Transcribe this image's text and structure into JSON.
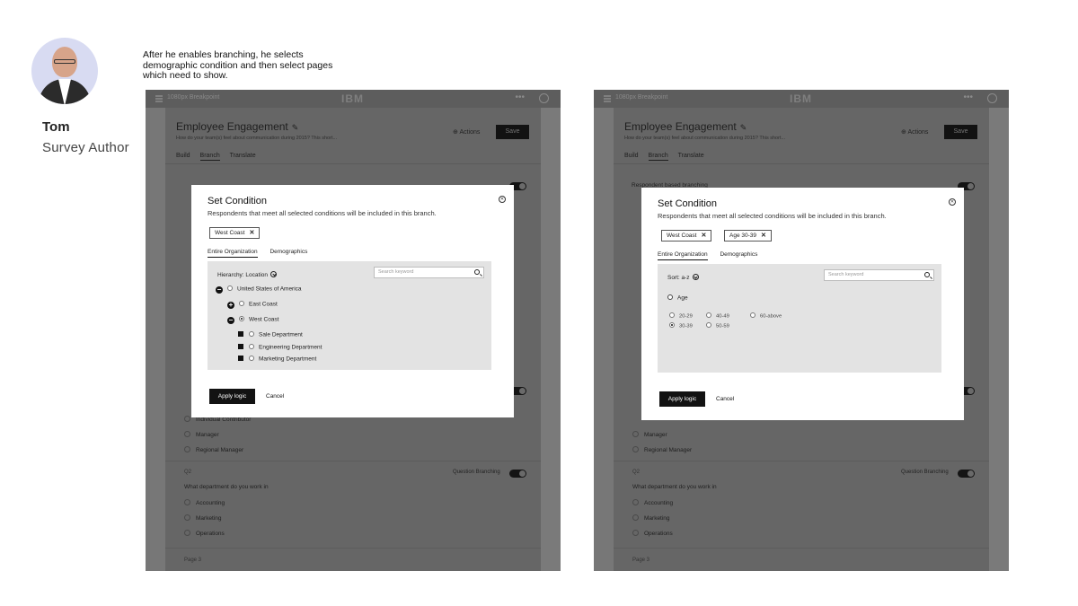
{
  "persona": {
    "name": "Tom",
    "role": "Survey Author",
    "caption": "After he enables branching, he selects demographic condition and then select pages which need to show."
  },
  "app": {
    "crumb": "1080px Breakpoint",
    "logo": "IBM",
    "more": "•••",
    "survey_title": "Employee Engagement",
    "survey_desc": "How do your team(s) feel about communication during 2015? This short...",
    "actions_label": "Actions",
    "save_label": "Save",
    "tabs": [
      "Build",
      "Branch",
      "Translate"
    ],
    "respondent_branching": "Respondent based branching",
    "question_branching": "Question Branching",
    "q1_options": [
      "Individual Contributor",
      "Manager",
      "Regional Manager"
    ],
    "q2_number": "Q2",
    "q2_text": "What department do you work in",
    "q2_options": [
      "Accounting",
      "Marketing",
      "Operations"
    ],
    "page3": "Page 3"
  },
  "modal1": {
    "title": "Set Condition",
    "subtitle": "Respondents that meet all selected conditions will be included in this branch.",
    "tags": [
      "West Coast"
    ],
    "tabs": [
      "Entire Organization",
      "Demographics"
    ],
    "hierarchy_label": "Hierarchy: Location",
    "search_placeholder": "Search keyword",
    "tree": {
      "country": "United States of America",
      "east": "East Coast",
      "west": "West Coast",
      "departments": [
        "Sale Department",
        "Engineering Department",
        "Marketing Department"
      ]
    },
    "apply_label": "Apply logic",
    "cancel_label": "Cancel"
  },
  "modal2": {
    "title": "Set Condition",
    "subtitle": "Respondents that meet all selected conditions will be included in this branch.",
    "tags": [
      "West Coast",
      "Age 30-39"
    ],
    "tabs": [
      "Entire Organization",
      "Demographics"
    ],
    "sort_label": "Sort: a-z",
    "search_placeholder": "Search keyword",
    "age_label": "Age",
    "age_options": [
      "20-29",
      "40-49",
      "60-above",
      "30-39",
      "50-59"
    ],
    "selected_age": "30-39",
    "apply_label": "Apply logic",
    "cancel_label": "Cancel"
  },
  "colors": {
    "overlay": "#6e6e6e",
    "modal": "#ffffff",
    "panel": "#e3e3e3",
    "primary_button": "#121212"
  }
}
